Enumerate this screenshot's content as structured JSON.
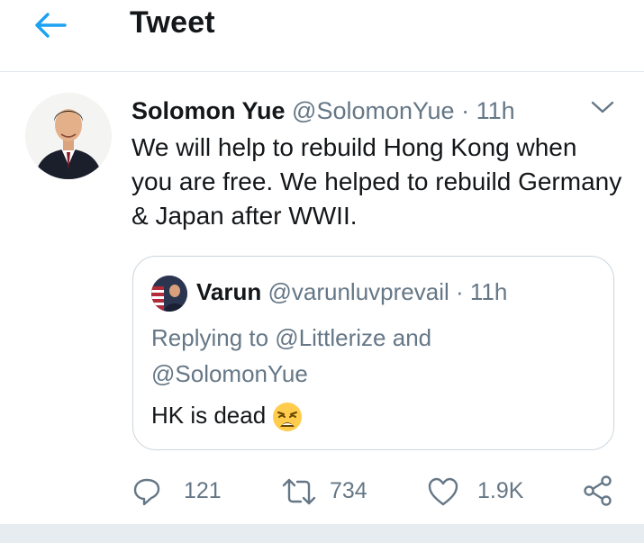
{
  "header": {
    "title": "Tweet",
    "back_icon": "arrow-left-icon"
  },
  "tweet": {
    "author_name": "Solomon Yue",
    "handle": "@SolomonYue",
    "separator": "·",
    "time": "11h",
    "text": "We will help to rebuild Hong Kong when you are free. We helped to rebuild Germany & Japan after WWII.",
    "more_icon": "chevron-down-icon"
  },
  "quoted_tweet": {
    "author_name": "Varun",
    "handle": "@varunluvprevail",
    "separator": "·",
    "time": "11h",
    "replying_to": "Replying to @Littlerize and @SolomonYue",
    "text": "HK is dead",
    "emoji": "weary-face-emoji"
  },
  "actions": {
    "reply_count": "121",
    "retweet_count": "734",
    "like_count": "1.9K"
  },
  "colors": {
    "accent": "#1da1f2",
    "secondary_text": "#657786",
    "border": "#ccd6dd",
    "divider": "#e1e8ed"
  }
}
